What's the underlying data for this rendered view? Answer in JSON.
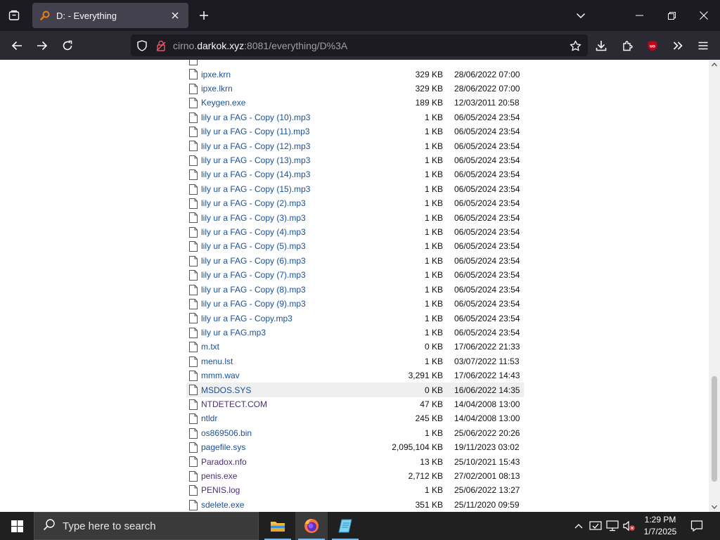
{
  "browser": {
    "tab_title": "D: - Everything",
    "url_host_prefix": "cirno.",
    "url_host_domain": "darkok.xyz",
    "url_rest": ":8081/everything/D%3A",
    "colors": {
      "tabstrip": "#1c1b22",
      "navbar": "#2b2a33",
      "active_tab": "#42414d",
      "link": "#1a4f97",
      "visited": "#4b2c7a"
    },
    "icons": [
      "tab-list-icon",
      "favicon-search-icon",
      "close-tab-icon",
      "new-tab-icon",
      "list-all-tabs-icon",
      "minimize-icon",
      "maximize-icon",
      "close-window-icon",
      "back-icon",
      "forward-icon",
      "reload-icon",
      "shield-icon",
      "lock-icon",
      "bookmark-star-icon",
      "download-icon",
      "extensions-icon",
      "ublock-icon",
      "overflow-icon",
      "menu-icon"
    ]
  },
  "files": [
    {
      "name": "ipxe.krn",
      "size": "329 KB",
      "date": "28/06/2022 07:00"
    },
    {
      "name": "ipxe.lkrn",
      "size": "329 KB",
      "date": "28/06/2022 07:00"
    },
    {
      "name": "Keygen.exe",
      "size": "189 KB",
      "date": "12/03/2011 20:58"
    },
    {
      "name": "lily ur a FAG - Copy (10).mp3",
      "size": "1 KB",
      "date": "06/05/2024 23:54"
    },
    {
      "name": "lily ur a FAG - Copy (11).mp3",
      "size": "1 KB",
      "date": "06/05/2024 23:54"
    },
    {
      "name": "lily ur a FAG - Copy (12).mp3",
      "size": "1 KB",
      "date": "06/05/2024 23:54"
    },
    {
      "name": "lily ur a FAG - Copy (13).mp3",
      "size": "1 KB",
      "date": "06/05/2024 23:54"
    },
    {
      "name": "lily ur a FAG - Copy (14).mp3",
      "size": "1 KB",
      "date": "06/05/2024 23:54"
    },
    {
      "name": "lily ur a FAG - Copy (15).mp3",
      "size": "1 KB",
      "date": "06/05/2024 23:54"
    },
    {
      "name": "lily ur a FAG - Copy (2).mp3",
      "size": "1 KB",
      "date": "06/05/2024 23:54"
    },
    {
      "name": "lily ur a FAG - Copy (3).mp3",
      "size": "1 KB",
      "date": "06/05/2024 23:54"
    },
    {
      "name": "lily ur a FAG - Copy (4).mp3",
      "size": "1 KB",
      "date": "06/05/2024 23:54"
    },
    {
      "name": "lily ur a FAG - Copy (5).mp3",
      "size": "1 KB",
      "date": "06/05/2024 23:54"
    },
    {
      "name": "lily ur a FAG - Copy (6).mp3",
      "size": "1 KB",
      "date": "06/05/2024 23:54"
    },
    {
      "name": "lily ur a FAG - Copy (7).mp3",
      "size": "1 KB",
      "date": "06/05/2024 23:54"
    },
    {
      "name": "lily ur a FAG - Copy (8).mp3",
      "size": "1 KB",
      "date": "06/05/2024 23:54"
    },
    {
      "name": "lily ur a FAG - Copy (9).mp3",
      "size": "1 KB",
      "date": "06/05/2024 23:54"
    },
    {
      "name": "lily ur a FAG - Copy.mp3",
      "size": "1 KB",
      "date": "06/05/2024 23:54"
    },
    {
      "name": "lily ur a FAG.mp3",
      "size": "1 KB",
      "date": "06/05/2024 23:54"
    },
    {
      "name": "m.txt",
      "size": "0 KB",
      "date": "17/06/2022 21:33"
    },
    {
      "name": "menu.lst",
      "size": "1 KB",
      "date": "03/07/2022 11:53"
    },
    {
      "name": "mmm.wav",
      "size": "3,291 KB",
      "date": "17/06/2022 14:43"
    },
    {
      "name": "MSDOS.SYS",
      "size": "0 KB",
      "date": "16/06/2022 14:35",
      "highlight": true
    },
    {
      "name": "NTDETECT.COM",
      "size": "47 KB",
      "date": "14/04/2008 13:00",
      "visited": true
    },
    {
      "name": "ntldr",
      "size": "245 KB",
      "date": "14/04/2008 13:00"
    },
    {
      "name": "os869506.bin",
      "size": "1 KB",
      "date": "25/06/2022 20:26"
    },
    {
      "name": "pagefile.sys",
      "size": "2,095,104 KB",
      "date": "19/11/2023 03:02"
    },
    {
      "name": "Paradox.nfo",
      "size": "13 KB",
      "date": "25/10/2021 15:43",
      "visited": true
    },
    {
      "name": "penis.exe",
      "size": "2,712 KB",
      "date": "27/02/2001 08:13",
      "visited": true
    },
    {
      "name": "PENIS.log",
      "size": "1 KB",
      "date": "25/06/2022 13:27",
      "visited": true
    },
    {
      "name": "sdelete.exe",
      "size": "351 KB",
      "date": "25/11/2020 09:59"
    }
  ],
  "taskbar": {
    "search_placeholder": "Type here to search",
    "time": "1:29 PM",
    "date": "1/7/2025",
    "apps": [
      "file-explorer",
      "firefox",
      "notepad"
    ],
    "icons": [
      "windows-start-icon",
      "search-icon",
      "file-explorer-icon",
      "firefox-icon",
      "notepad-icon",
      "show-hidden-icons-chevron",
      "security-icon",
      "network-icon",
      "volume-muted-icon",
      "notification-icon"
    ]
  }
}
